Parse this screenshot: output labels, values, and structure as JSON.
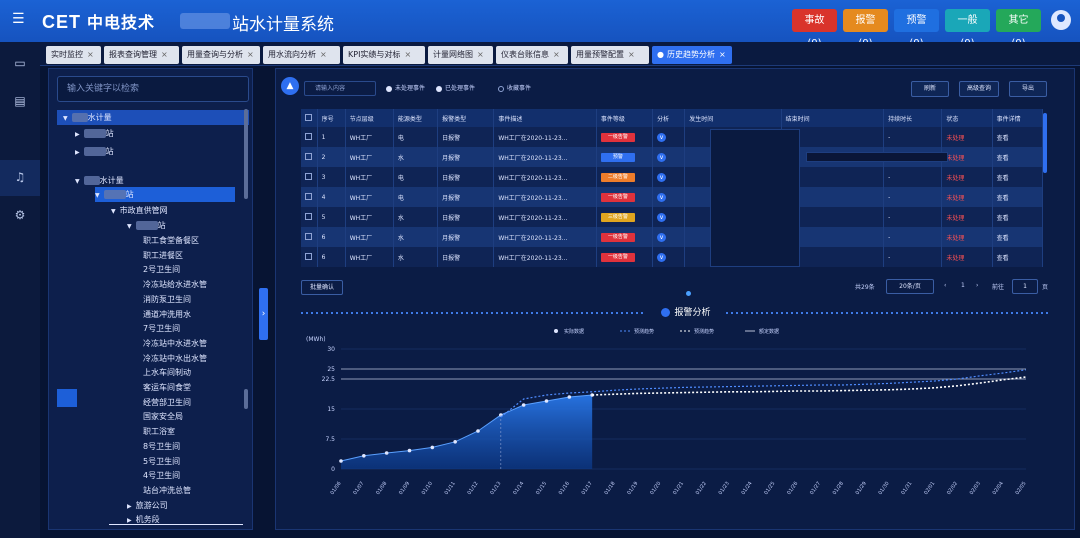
{
  "header": {
    "logo_en": "CET",
    "logo_cn": "中电技术",
    "system_title": "站水计量系统",
    "alarms": [
      {
        "label": "事故(0)",
        "color": "#d9342b"
      },
      {
        "label": "报警(0)",
        "color": "#e58a1f"
      },
      {
        "label": "预警(0)",
        "color": "#1f6fe0"
      },
      {
        "label": "一般(0)",
        "color": "#1aa7b8"
      },
      {
        "label": "其它(0)",
        "color": "#24a85a"
      }
    ]
  },
  "leftnav": {
    "icons": [
      "monitor-icon",
      "clipboard-icon",
      "bell-icon",
      "settings-icon"
    ]
  },
  "tabs": [
    {
      "label": "实时监控"
    },
    {
      "label": "报表查询管理"
    },
    {
      "label": "用量查询与分析"
    },
    {
      "label": "用水流向分析"
    },
    {
      "label": "KPI实绩与对标"
    },
    {
      "label": "计量网络图"
    },
    {
      "label": "仪表台账信息"
    },
    {
      "label": "用量预警配置"
    },
    {
      "label": "历史趋势分析",
      "active": true
    }
  ],
  "tree": {
    "search_placeholder": "输入关键字以检索",
    "nodes": [
      {
        "label": "水计量",
        "level": 0,
        "arrow": "▼"
      },
      {
        "label": "站",
        "level": 1,
        "arrow": "▶"
      },
      {
        "label": "站",
        "level": 1,
        "arrow": "▶"
      },
      {
        "label": "水计量",
        "level": 1,
        "arrow": "▼"
      },
      {
        "label": "站",
        "level": 2,
        "arrow": "▼"
      },
      {
        "label": "市政直供管网",
        "level": 3,
        "arrow": "▼"
      },
      {
        "label": "站",
        "level": 4,
        "arrow": "▼"
      },
      {
        "label": "职工食堂备餐区",
        "level": 5
      },
      {
        "label": "职工进餐区",
        "level": 5
      },
      {
        "label": "2号卫生间",
        "level": 5
      },
      {
        "label": "冷冻站给水进水管",
        "level": 5
      },
      {
        "label": "消防泵卫生间",
        "level": 5
      },
      {
        "label": "通道冲洗用水",
        "level": 5
      },
      {
        "label": "7号卫生间",
        "level": 5
      },
      {
        "label": "冷冻站中水进水管",
        "level": 5
      },
      {
        "label": "冷冻站中水出水管",
        "level": 5
      },
      {
        "label": "上水车间制动",
        "level": 5
      },
      {
        "label": "客运车间食堂",
        "level": 5
      },
      {
        "label": "经营部卫生间",
        "level": 5
      },
      {
        "label": "国家安全局",
        "level": 5
      },
      {
        "label": "职工浴室",
        "level": 5
      },
      {
        "label": "8号卫生间",
        "level": 5
      },
      {
        "label": "5号卫生间",
        "level": 5
      },
      {
        "label": "4号卫生间",
        "level": 5
      },
      {
        "label": "站台冲洗总管",
        "level": 5
      },
      {
        "label": "旅游公司",
        "level": 4,
        "arrow": "▶"
      },
      {
        "label": "机务段",
        "level": 4,
        "arrow": "▶"
      }
    ]
  },
  "filter": {
    "placeholder": "请输入内容",
    "radios": [
      {
        "label": "未处理事件",
        "on": true
      },
      {
        "label": "已处理事件",
        "on": true
      },
      {
        "label": "收藏事件",
        "on": false
      }
    ],
    "buttons": [
      "刷新",
      "高级查询",
      "导出"
    ]
  },
  "table": {
    "columns": [
      "",
      "序号",
      "节点层级",
      "能源类型",
      "报警类型",
      "事件描述",
      "事件等级",
      "分析",
      "发生时间",
      "结束时间",
      "持续时长",
      "状态",
      "事件详情"
    ],
    "rows": [
      {
        "no": "1",
        "node": "WH工厂",
        "energy": "电",
        "type": "日报警",
        "desc": "WH工厂在2020-11-23...",
        "level": "一级告警",
        "level_color": "#e0323c",
        "end": "-",
        "dur": "-",
        "status": "未处理",
        "detail": "查看"
      },
      {
        "no": "2",
        "node": "WH工厂",
        "energy": "水",
        "type": "月报警",
        "desc": "WH工厂在2020-11-23...",
        "level": "预警",
        "level_color": "#2f6ff0",
        "end": "",
        "dur": "",
        "status": "未处理",
        "detail": "查看"
      },
      {
        "no": "3",
        "node": "WH工厂",
        "energy": "电",
        "type": "日报警",
        "desc": "WH工厂在2020-11-23...",
        "level": "二级告警",
        "level_color": "#ee7d2b",
        "end": "-",
        "dur": "-",
        "status": "未处理",
        "detail": "查看"
      },
      {
        "no": "4",
        "node": "WH工厂",
        "energy": "电",
        "type": "月报警",
        "desc": "WH工厂在2020-11-23...",
        "level": "一级告警",
        "level_color": "#e0323c",
        "end": "-",
        "dur": "-",
        "status": "未处理",
        "detail": "查看"
      },
      {
        "no": "5",
        "node": "WH工厂",
        "energy": "水",
        "type": "日报警",
        "desc": "WH工厂在2020-11-23...",
        "level": "三级告警",
        "level_color": "#e0a51f",
        "end": "-",
        "dur": "-",
        "status": "未处理",
        "detail": "查看"
      },
      {
        "no": "6",
        "node": "WH工厂",
        "energy": "水",
        "type": "月报警",
        "desc": "WH工厂在2020-11-23...",
        "level": "一级告警",
        "level_color": "#e0323c",
        "end": "-",
        "dur": "-",
        "status": "未处理",
        "detail": "查看"
      },
      {
        "no": "6",
        "node": "WH工厂",
        "energy": "水",
        "type": "日报警",
        "desc": "WH工厂在2020-11-23...",
        "level": "一级告警",
        "level_color": "#e0323c",
        "end": "-",
        "dur": "-",
        "status": "未处理",
        "detail": "查看"
      }
    ]
  },
  "pager": {
    "batch": "批量确认",
    "total": "共29条",
    "page_size": "20条/页",
    "current": "1",
    "goto_label": "前往",
    "goto_value": "1",
    "page_suffix": "页"
  },
  "chart_data": {
    "type": "line",
    "title": "报警分析",
    "ylabel": "(MWh)",
    "yticks": [
      "30",
      "22.5",
      "25",
      "15",
      "7.5",
      "0"
    ],
    "ylim": [
      0,
      30
    ],
    "thresholds": [
      25,
      22.5
    ],
    "series": [
      {
        "name": "实际数据",
        "style": "solid-points"
      },
      {
        "name": "预测趋势",
        "style": "dashed-blue"
      },
      {
        "name": "预测趋势",
        "style": "dashed-white"
      },
      {
        "name": "额定数据",
        "style": "solid-gray"
      }
    ],
    "x": [
      "01/06",
      "01/07",
      "01/08",
      "01/09",
      "01/10",
      "01/11",
      "01/12",
      "01/13",
      "01/14",
      "01/15",
      "01/16",
      "01/17",
      "01/18",
      "01/19",
      "01/20",
      "01/21",
      "01/22",
      "01/23",
      "01/24",
      "01/25",
      "01/26",
      "01/27",
      "01/28",
      "01/29",
      "01/30",
      "01/31",
      "02/01",
      "02/02",
      "02/03",
      "02/04",
      "02/05"
    ],
    "actual": [
      2.0,
      3.3,
      4.0,
      4.6,
      5.4,
      6.8,
      9.5,
      13.5,
      16.0,
      17.0,
      18.0,
      18.5
    ],
    "forecast_blue": [
      null,
      null,
      null,
      null,
      null,
      null,
      null,
      13.0,
      17.5,
      18.5,
      19.0,
      19.3,
      19.7,
      20.0,
      20.2,
      20.4,
      20.5,
      20.6,
      20.7,
      20.8,
      20.9,
      21.0,
      21.0,
      21.2,
      21.4,
      21.7,
      22.0,
      22.5,
      23.3,
      24.0,
      24.8
    ],
    "forecast_white": [
      null,
      null,
      null,
      null,
      null,
      null,
      null,
      null,
      null,
      null,
      null,
      18.5,
      18.7,
      18.9,
      19.0,
      19.1,
      19.2,
      19.3,
      19.3,
      19.4,
      19.5,
      19.5,
      19.6,
      19.7,
      19.8,
      20.0,
      20.3,
      20.8,
      21.5,
      22.3,
      23.0
    ],
    "rated": 25
  }
}
